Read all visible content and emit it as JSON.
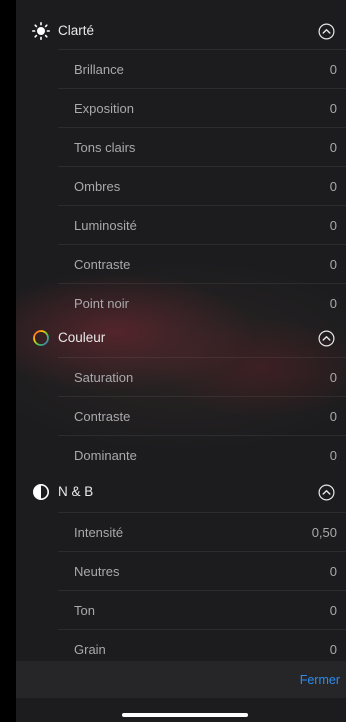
{
  "sections": [
    {
      "title": "Clarté",
      "icon": "sun-icon",
      "rows": [
        {
          "label": "Brillance",
          "value": "0"
        },
        {
          "label": "Exposition",
          "value": "0"
        },
        {
          "label": "Tons clairs",
          "value": "0"
        },
        {
          "label": "Ombres",
          "value": "0"
        },
        {
          "label": "Luminosité",
          "value": "0"
        },
        {
          "label": "Contraste",
          "value": "0"
        },
        {
          "label": "Point noir",
          "value": "0"
        }
      ]
    },
    {
      "title": "Couleur",
      "icon": "color-wheel-icon",
      "rows": [
        {
          "label": "Saturation",
          "value": "0"
        },
        {
          "label": "Contraste",
          "value": "0"
        },
        {
          "label": "Dominante",
          "value": "0"
        }
      ]
    },
    {
      "title": "N & B",
      "icon": "half-circle-icon",
      "rows": [
        {
          "label": "Intensité",
          "value": "0,50"
        },
        {
          "label": "Neutres",
          "value": "0"
        },
        {
          "label": "Ton",
          "value": "0"
        },
        {
          "label": "Grain",
          "value": "0"
        }
      ]
    }
  ],
  "footer": {
    "close_label": "Fermer"
  },
  "colors": {
    "accent": "#2a8cf0",
    "panel": "#1c1c1e"
  }
}
